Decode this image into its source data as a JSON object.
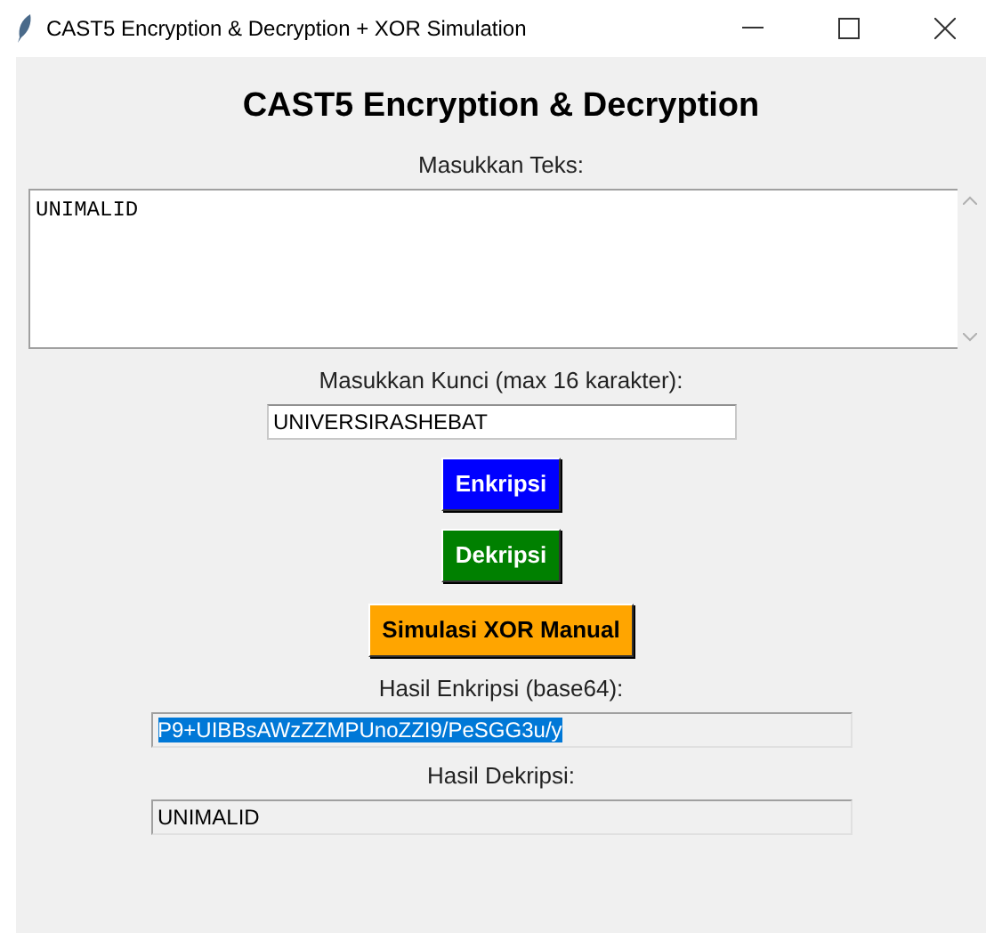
{
  "window": {
    "title": "CAST5 Encryption & Decryption + XOR Simulation"
  },
  "heading": "CAST5 Encryption & Decryption",
  "text_input": {
    "label": "Masukkan Teks:",
    "value": "UNIMALID"
  },
  "key_input": {
    "label": "Masukkan Kunci (max 16 karakter):",
    "value": "UNIVERSIRASHEBAT"
  },
  "buttons": [
    {
      "label": "Enkripsi",
      "color": "#0000ff"
    },
    {
      "label": "Dekripsi",
      "color": "#008000"
    },
    {
      "label": "Simulasi XOR Manual",
      "color": "#ffa500"
    }
  ],
  "outputs": [
    {
      "label": "Hasil Enkripsi (base64):",
      "value": "P9+UIBBsAWzZZMPUnoZZI9/PeSGG3u/y",
      "selected": true
    },
    {
      "label": "Hasil Dekripsi:",
      "value": "UNIMALID",
      "selected": false
    }
  ]
}
